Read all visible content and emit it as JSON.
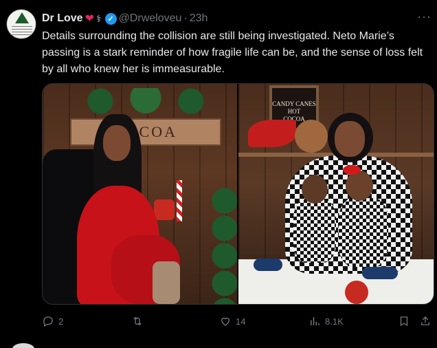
{
  "tweet": {
    "author": {
      "name": "Dr Love",
      "handle": "@Drweloveu",
      "time": "23h",
      "avatar_icon": "profile-avatar",
      "emoji": [
        "heart",
        "stethoscope"
      ],
      "verified": true
    },
    "text": "Details surrounding the collision are still being investigated. Neto Marie’s passing is a stark reminder of how fragile life can be, and the sense of loss felt by all who knew her is immeasurable.",
    "media": {
      "left_photo": {
        "sign_text": "COCOA"
      },
      "right_photo": {
        "sign_text": [
          "CANDY CANES",
          "HOT",
          "COCOA"
        ]
      }
    },
    "actions": {
      "reply_count": "2",
      "repost_count": "",
      "like_count": "14",
      "views_count": "8.1K"
    }
  },
  "colors": {
    "background": "#000000",
    "text": "#e7e9ea",
    "muted": "#71767b",
    "verified": "#1d9bf0",
    "heart": "#e0245e"
  }
}
